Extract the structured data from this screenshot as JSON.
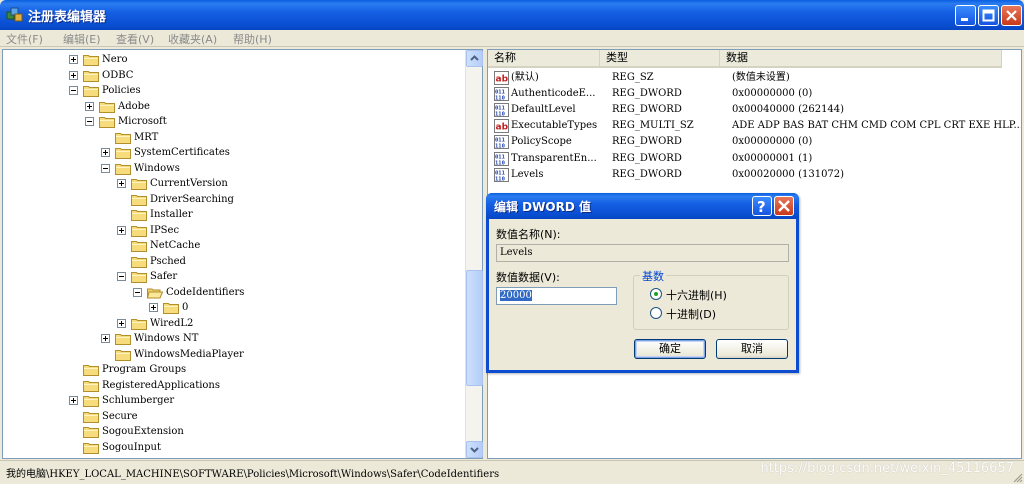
{
  "window": {
    "title": "注册表编辑器",
    "icon": "registry-editor-icon"
  },
  "menu": [
    "文件(F)",
    "编辑(E)",
    "查看(V)",
    "收藏夹(A)",
    "帮助(H)"
  ],
  "tree": [
    {
      "label": "Nero",
      "level": 0,
      "exp": "plus"
    },
    {
      "label": "ODBC",
      "level": 0,
      "exp": "plus"
    },
    {
      "label": "Policies",
      "level": 0,
      "exp": "minus"
    },
    {
      "label": "Adobe",
      "level": 1,
      "exp": "plus"
    },
    {
      "label": "Microsoft",
      "level": 1,
      "exp": "minus"
    },
    {
      "label": "MRT",
      "level": 2,
      "exp": "none"
    },
    {
      "label": "SystemCertificates",
      "level": 2,
      "exp": "plus"
    },
    {
      "label": "Windows",
      "level": 2,
      "exp": "minus"
    },
    {
      "label": "CurrentVersion",
      "level": 3,
      "exp": "plus"
    },
    {
      "label": "DriverSearching",
      "level": 3,
      "exp": "none"
    },
    {
      "label": "Installer",
      "level": 3,
      "exp": "none"
    },
    {
      "label": "IPSec",
      "level": 3,
      "exp": "plus"
    },
    {
      "label": "NetCache",
      "level": 3,
      "exp": "none"
    },
    {
      "label": "Psched",
      "level": 3,
      "exp": "none"
    },
    {
      "label": "Safer",
      "level": 3,
      "exp": "minus"
    },
    {
      "label": "CodeIdentifiers",
      "level": 4,
      "exp": "minus",
      "open": true
    },
    {
      "label": "0",
      "level": 5,
      "exp": "plus"
    },
    {
      "label": "WiredL2",
      "level": 3,
      "exp": "plus"
    },
    {
      "label": "Windows NT",
      "level": 2,
      "exp": "plus"
    },
    {
      "label": "WindowsMediaPlayer",
      "level": 2,
      "exp": "none"
    },
    {
      "label": "Program Groups",
      "level": -1,
      "exp": "none"
    },
    {
      "label": "RegisteredApplications",
      "level": -1,
      "exp": "none"
    },
    {
      "label": "Schlumberger",
      "level": -1,
      "exp": "plus"
    },
    {
      "label": "Secure",
      "level": -1,
      "exp": "none"
    },
    {
      "label": "SogouExtension",
      "level": -1,
      "exp": "none"
    },
    {
      "label": "SogouInput",
      "level": -1,
      "exp": "none"
    }
  ],
  "columns": {
    "name": "名称",
    "type": "类型",
    "data": "数据"
  },
  "values": [
    {
      "icon": "ab",
      "name": "(默认)",
      "type": "REG_SZ",
      "data": "(数值未设置)"
    },
    {
      "icon": "bin",
      "name": "AuthenticodeE...",
      "type": "REG_DWORD",
      "data": "0x00000000 (0)"
    },
    {
      "icon": "bin",
      "name": "DefaultLevel",
      "type": "REG_DWORD",
      "data": "0x00040000 (262144)"
    },
    {
      "icon": "ab",
      "name": "ExecutableTypes",
      "type": "REG_MULTI_SZ",
      "data": "ADE ADP BAS BAT CHM CMD COM CPL CRT EXE HLP..."
    },
    {
      "icon": "bin",
      "name": "PolicyScope",
      "type": "REG_DWORD",
      "data": "0x00000000 (0)"
    },
    {
      "icon": "bin",
      "name": "TransparentEn...",
      "type": "REG_DWORD",
      "data": "0x00000001 (1)"
    },
    {
      "icon": "bin",
      "name": "Levels",
      "type": "REG_DWORD",
      "data": "0x00020000 (131072)"
    }
  ],
  "dialog": {
    "title": "编辑 DWORD 值",
    "name_label": "数值名称(N):",
    "name_value": "Levels",
    "data_label": "数值数据(V):",
    "data_value": "20000",
    "base_label": "基数",
    "hex_label": "十六进制(H)",
    "dec_label": "十进制(D)",
    "selected_base": "hex",
    "ok": "确定",
    "cancel": "取消"
  },
  "status": {
    "path": "我的电脑\\HKEY_LOCAL_MACHINE\\SOFTWARE\\Policies\\Microsoft\\Windows\\Safer\\CodeIdentifiers",
    "watermark": "https://blog.csdn.net/weixin_45116657"
  }
}
